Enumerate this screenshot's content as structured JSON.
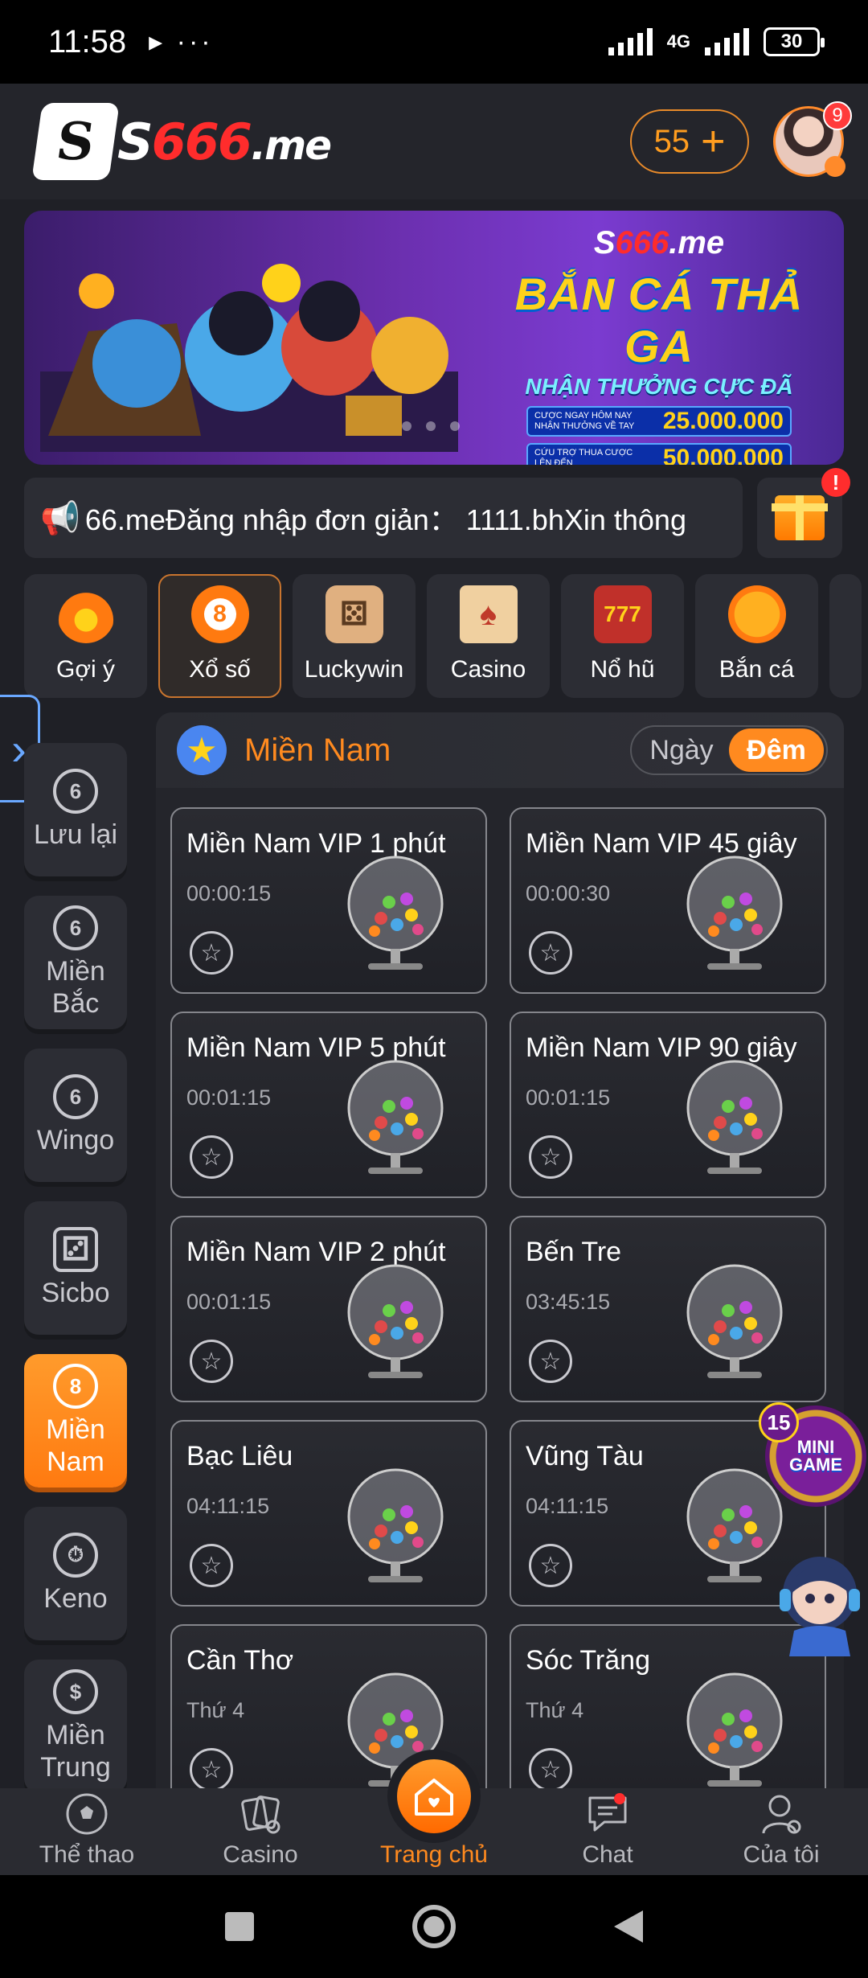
{
  "status_bar": {
    "time": "11:58",
    "extra": "▸ ···",
    "network": "4G",
    "battery": "30"
  },
  "header": {
    "logo_prefix": "S",
    "logo_brand_digits": "666",
    "logo_brand_s": "S",
    "logo_suffix": ".me",
    "coins": "55",
    "plus": "+",
    "avatar_badge": "9"
  },
  "banner": {
    "brand_s": "S",
    "brand_digits": "666",
    "brand_suffix": ".me",
    "title": "BẮN CÁ THẢ GA",
    "subtitle": "NHẬN THƯỞNG CỰC ĐÃ",
    "row1_text": "CƯỢC NGAY HÔM NAY NHẬN THƯỞNG VỀ TAY",
    "row1_amount": "25.000.000",
    "row2_text": "CỨU TRỢ THUA CƯỢC LÊN ĐẾN",
    "row2_amount": "50.000.000"
  },
  "marquee": {
    "text": "66.meĐăng nhập đơn giản： 1111.bhXin thông"
  },
  "gift": {
    "alert": "!"
  },
  "categories": [
    {
      "label": "Gợi ý"
    },
    {
      "label": "Xổ số"
    },
    {
      "label": "Luckywin"
    },
    {
      "label": "Casino"
    },
    {
      "label": "Nổ hũ"
    },
    {
      "label": "Bắn cá"
    }
  ],
  "sidebar": [
    {
      "label": "Lưu lại",
      "icon": "6"
    },
    {
      "label": "Miền Bắc",
      "icon": "6"
    },
    {
      "label": "Wingo",
      "icon": "6"
    },
    {
      "label": "Sicbo",
      "icon": "⚂"
    },
    {
      "label": "Miền Nam",
      "icon": "8"
    },
    {
      "label": "Keno",
      "icon": "⏱"
    },
    {
      "label": "Miền Trung",
      "icon": "$"
    }
  ],
  "panel": {
    "title": "Miền Nam",
    "toggle_day": "Ngày",
    "toggle_night": "Đêm"
  },
  "games": [
    {
      "title": "Miền Nam VIP 1 phút",
      "time": "00:00:15"
    },
    {
      "title": "Miền Nam VIP 45 giây",
      "time": "00:00:30"
    },
    {
      "title": "Miền Nam VIP 5 phút",
      "time": "00:01:15"
    },
    {
      "title": "Miền Nam VIP 90 giây",
      "time": "00:01:15"
    },
    {
      "title": "Miền Nam VIP 2 phút",
      "time": "00:01:15"
    },
    {
      "title": "Bến Tre",
      "time": "03:45:15"
    },
    {
      "title": "Bạc Liêu",
      "time": "04:11:15"
    },
    {
      "title": "Vũng Tàu",
      "time": "04:11:15"
    },
    {
      "title": "Cần Thơ",
      "time": "Thứ 4"
    },
    {
      "title": "Sóc Trăng",
      "time": "Thứ 4"
    }
  ],
  "mini_game": {
    "count": "15",
    "line1": "MINI",
    "line2": "GAME"
  },
  "bottom_nav": [
    {
      "label": "Thể thao"
    },
    {
      "label": "Casino"
    },
    {
      "label": "Trang chủ"
    },
    {
      "label": "Chat"
    },
    {
      "label": "Của tôi"
    }
  ],
  "colors": {
    "accent": "#ff8a1f",
    "background": "#1f2026",
    "card": "#2c2d34",
    "link_blue": "#6aa8ff"
  }
}
